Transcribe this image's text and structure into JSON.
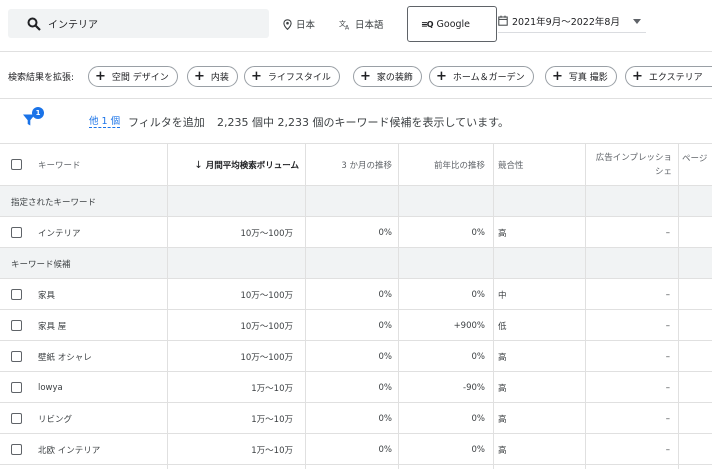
{
  "search": {
    "query": "インテリア"
  },
  "toolbar": {
    "location": "日本",
    "language": "日本語",
    "network": "Google",
    "date_range": "2021年9月～2022年8月"
  },
  "refine": {
    "label": "検索結果を拡張:",
    "chips": [
      "空間 デザイン",
      "内装",
      "ライフスタイル",
      "家の装飾",
      "ホーム＆ガーデン",
      "写真 撮影",
      "エクステリア"
    ]
  },
  "filters": {
    "badge_count": "1",
    "other_link": "他 1 個",
    "add_filter": "フィルタを追加",
    "summary": "2,235 個中 2,233 個のキーワード候補を表示しています。"
  },
  "table": {
    "headers": {
      "keyword": "キーワード",
      "volume": "月間平均検索ボリューム",
      "three_month": "3 か月の推移",
      "yoy": "前年比の推移",
      "competition": "競合性",
      "ad_impression_line1": "広告インプレッショ",
      "ad_impression_line2": "シェ",
      "page": "ページ"
    },
    "section_specified": "指定されたキーワード",
    "specified": [
      {
        "keyword": "インテリア",
        "volume": "10万～100万",
        "three_month": "0%",
        "yoy": "0%",
        "competition": "高",
        "impression": "–"
      }
    ],
    "section_ideas": "キーワード候補",
    "ideas": [
      {
        "keyword": "家具",
        "volume": "10万～100万",
        "three_month": "0%",
        "yoy": "0%",
        "competition": "中",
        "impression": "–"
      },
      {
        "keyword": "家具 屋",
        "volume": "10万～100万",
        "three_month": "0%",
        "yoy": "+900%",
        "competition": "低",
        "impression": "–"
      },
      {
        "keyword": "壁紙 オシャレ",
        "volume": "10万～100万",
        "three_month": "0%",
        "yoy": "0%",
        "competition": "高",
        "impression": "–"
      },
      {
        "keyword": "lowya",
        "volume": "1万～10万",
        "three_month": "0%",
        "yoy": "-90%",
        "competition": "高",
        "impression": "–"
      },
      {
        "keyword": "リビング",
        "volume": "1万～10万",
        "three_month": "0%",
        "yoy": "0%",
        "competition": "高",
        "impression": "–"
      },
      {
        "keyword": "北欧 インテリア",
        "volume": "1万～10万",
        "three_month": "0%",
        "yoy": "0%",
        "competition": "高",
        "impression": "–"
      }
    ]
  }
}
